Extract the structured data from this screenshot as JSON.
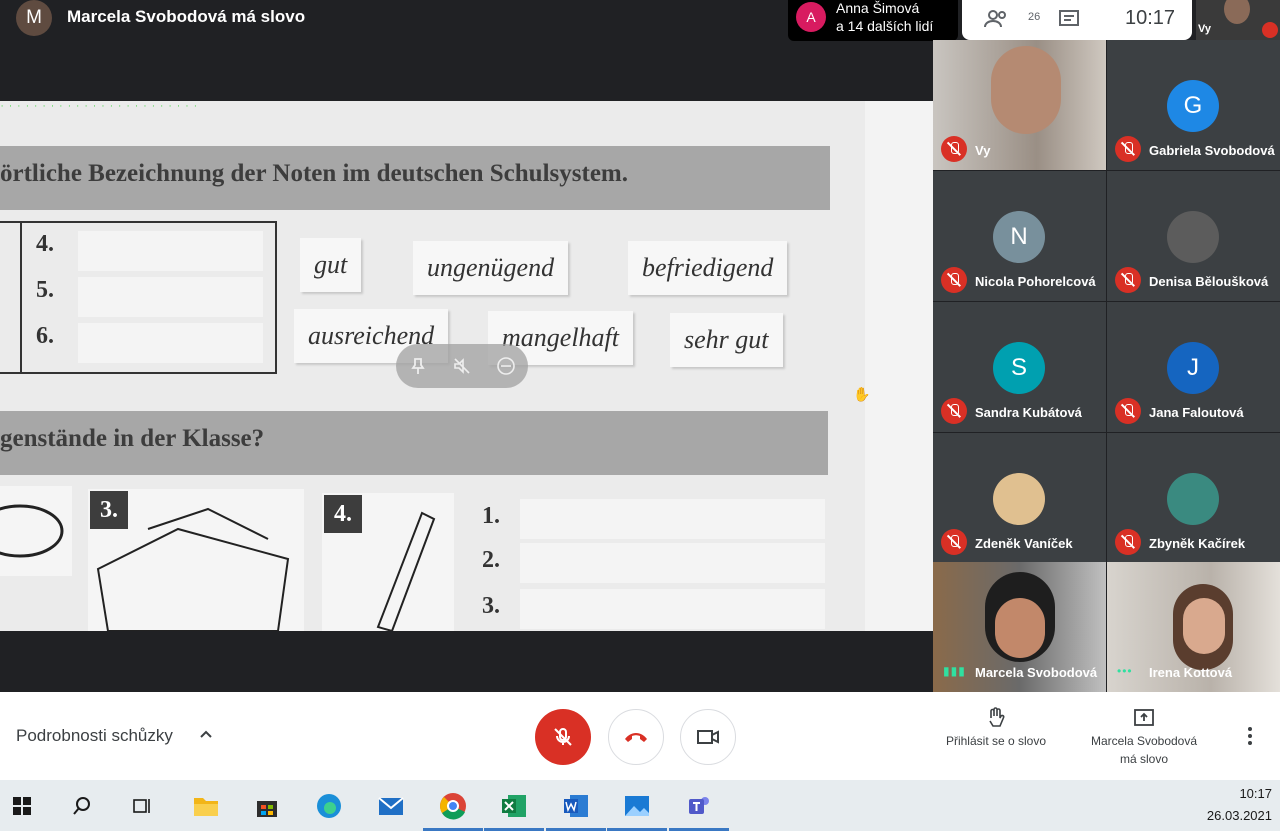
{
  "header": {
    "presenter_initial": "M",
    "presenter_title": "Marcela Svobodová má slovo",
    "participants_initial": "A",
    "participants_line1": "Anna Šimová",
    "participants_line2": "a 14 dalších lidí",
    "people_count": "26",
    "time": "10:17",
    "self_label": "Vy"
  },
  "presentation": {
    "banner1": "örtliche Bezeichnung der Noten im deutschen Schulsystem.",
    "banner2": "genstände in der Klasse?",
    "grades": [
      "4.",
      "5.",
      "6."
    ],
    "words": [
      "gut",
      "ungenügend",
      "befriedigend",
      "ausreichend",
      "mangelhaft",
      "sehr gut"
    ],
    "image_numbers": [
      "3.",
      "4."
    ],
    "answer_numbers": [
      "1.",
      "2.",
      "3."
    ]
  },
  "tiles": [
    {
      "name": "Vy",
      "initial": "",
      "color": "",
      "video": true
    },
    {
      "name": "Gabriela Svobodová",
      "initial": "G",
      "color": "#1e88e5"
    },
    {
      "name": "Nicola Pohorelcová",
      "initial": "N",
      "color": "#78909c"
    },
    {
      "name": "Denisa Běloušková",
      "initial": "",
      "color": "#5c5c5c"
    },
    {
      "name": "Sandra Kubátová",
      "initial": "S",
      "color": "#00a0b0"
    },
    {
      "name": "Jana Faloutová",
      "initial": "J",
      "color": "#1565c0"
    },
    {
      "name": "Zdeněk Vaníček",
      "initial": "",
      "color": "#e0c090"
    },
    {
      "name": "Zbyněk Kačírek",
      "initial": "",
      "color": "#3a8a80"
    },
    {
      "name": "Marcela Svobodová",
      "initial": "",
      "color": "",
      "video": true
    },
    {
      "name": "Irena Kottová",
      "initial": "",
      "color": "",
      "video": true
    }
  ],
  "controls": {
    "meeting_details": "Podrobnosti schůzky",
    "raise_hand": "Přihlásit se o slovo",
    "present_line1": "Marcela Svobodová",
    "present_line2": "má slovo"
  },
  "taskbar": {
    "time": "10:17",
    "date": "26.03.2021"
  },
  "colors": {
    "accent_red": "#d93025",
    "background": "#202124"
  }
}
